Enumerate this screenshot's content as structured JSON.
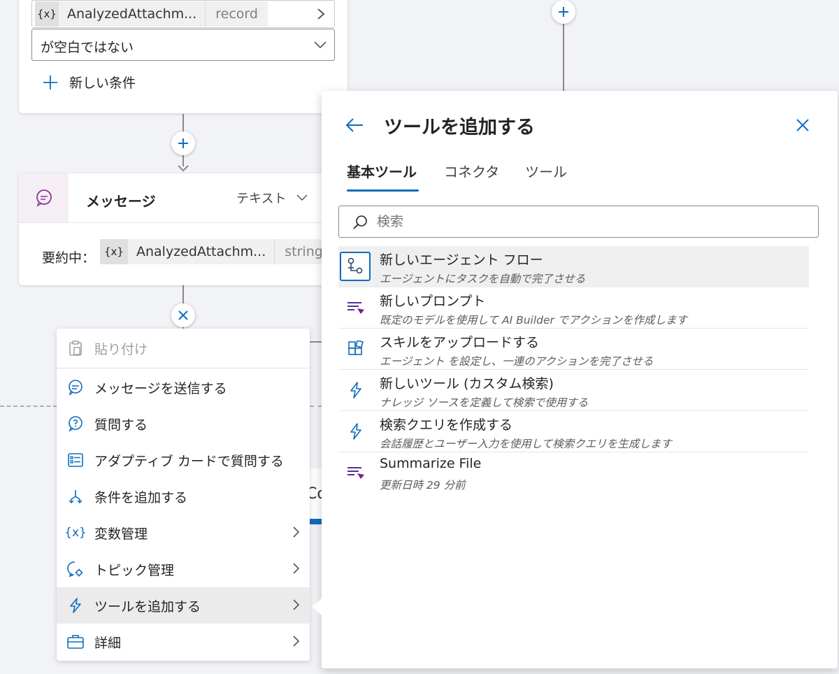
{
  "condition_card": {
    "variable_icon": "{x}",
    "variable_name": "AnalyzedAttachm...",
    "variable_type": "record",
    "operator": "が空白ではない",
    "new_condition_label": "新しい条件"
  },
  "message_card": {
    "title": "メッセージ",
    "type_label": "テキスト",
    "prefix_label": "要約中：",
    "variable_icon": "{x}",
    "variable_name": "AnalyzedAttachm...",
    "variable_type": "string"
  },
  "canvas": {
    "partial_text": "Co"
  },
  "context_menu": {
    "items": [
      {
        "label": "貼り付け",
        "icon": "clipboard-icon",
        "disabled": true
      },
      {
        "label": "メッセージを送信する",
        "icon": "chat-bubble-icon"
      },
      {
        "label": "質問する",
        "icon": "question-icon"
      },
      {
        "label": "アダプティブ カードで質問する",
        "icon": "form-card-icon"
      },
      {
        "label": "条件を追加する",
        "icon": "branch-icon"
      },
      {
        "label": "変数管理",
        "icon": "variable-icon",
        "submenu": true
      },
      {
        "label": "トピック管理",
        "icon": "topic-gear-icon",
        "submenu": true
      },
      {
        "label": "ツールを追加する",
        "icon": "lightning-icon",
        "submenu": true,
        "active": true
      },
      {
        "label": "詳細",
        "icon": "briefcase-icon",
        "submenu": true
      }
    ]
  },
  "tool_panel": {
    "title": "ツールを追加する",
    "tabs": [
      "基本ツール",
      "コネクタ",
      "ツール"
    ],
    "selected_tab": 0,
    "search_placeholder": "検索",
    "accent_color": "#0f6cbd",
    "tools": [
      {
        "title": "新しいエージェント フロー",
        "subtitle": "エージェントにタスクを自動で完了させる",
        "icon": "flow-icon"
      },
      {
        "title": "新しいプロンプト",
        "subtitle": "既定のモデルを使用して AI Builder でアクションを作成します",
        "icon": "prompt-icon"
      },
      {
        "title": "スキルをアップロードする",
        "subtitle": "エージェント を設定し、一連のアクションを完了させる",
        "icon": "skill-icon"
      },
      {
        "title": "新しいツール (カスタム検索)",
        "subtitle": "ナレッジ ソースを定義して検索で使用する",
        "icon": "lightning-icon"
      },
      {
        "title": "検索クエリを作成する",
        "subtitle": "会話履歴とユーザー入力を使用して検索クエリを生成します",
        "icon": "lightning-icon"
      },
      {
        "title": "Summarize File",
        "subtitle": "更新日時 29 分前",
        "icon": "prompt-icon"
      }
    ]
  }
}
